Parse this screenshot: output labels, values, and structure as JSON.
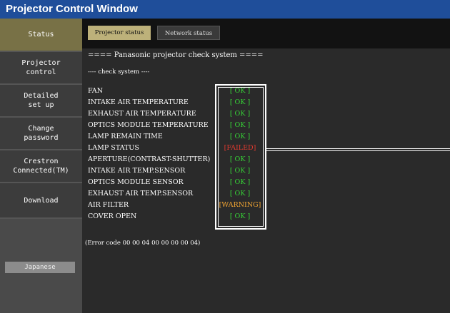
{
  "window": {
    "title": "Projector Control Window"
  },
  "sidebar": {
    "items": [
      {
        "label": "Status",
        "active": true
      },
      {
        "label": "Projector\ncontrol",
        "active": false
      },
      {
        "label": "Detailed\nset up",
        "active": false
      },
      {
        "label": "Change\npassword",
        "active": false
      },
      {
        "label": "Crestron\nConnected(TM)",
        "active": false
      },
      {
        "label": "Download",
        "active": false
      }
    ],
    "language_button": "Japanese"
  },
  "tabs": [
    {
      "label": "Projector status",
      "active": true
    },
    {
      "label": "Network status",
      "active": false
    }
  ],
  "main": {
    "heading": "==== Panasonic projector check system ====",
    "subheading": "---- check system ----",
    "checks": [
      {
        "label": "FAN",
        "status": "[ OK ]",
        "level": "ok"
      },
      {
        "label": "INTAKE AIR TEMPERATURE",
        "status": "[ OK ]",
        "level": "ok"
      },
      {
        "label": "EXHAUST AIR TEMPERATURE",
        "status": "[ OK ]",
        "level": "ok"
      },
      {
        "label": "OPTICS MODULE TEMPERATURE",
        "status": "[ OK ]",
        "level": "ok"
      },
      {
        "label": "LAMP REMAIN TIME",
        "status": "[ OK ]",
        "level": "ok"
      },
      {
        "label": "LAMP STATUS",
        "status": "[FAILED]",
        "level": "failed"
      },
      {
        "label": "APERTURE(CONTRAST-SHUTTER)",
        "status": "[ OK ]",
        "level": "ok"
      },
      {
        "label": "INTAKE AIR TEMP.SENSOR",
        "status": "[ OK ]",
        "level": "ok"
      },
      {
        "label": "OPTICS MODULE SENSOR",
        "status": "[ OK ]",
        "level": "ok"
      },
      {
        "label": "EXHAUST AIR TEMP.SENSOR",
        "status": "[ OK ]",
        "level": "ok"
      },
      {
        "label": "AIR FILTER",
        "status": "[WARNING]",
        "level": "warning"
      },
      {
        "label": "COVER OPEN",
        "status": "[ OK ]",
        "level": "ok"
      }
    ],
    "error_code": "(Error code 00 00 04 00 00 00 00 04)"
  },
  "colors": {
    "titlebar": "#1f4e9a",
    "active_nav": "#787146",
    "ok": "#37d337",
    "failed": "#e03a2f",
    "warning": "#f2a533"
  }
}
